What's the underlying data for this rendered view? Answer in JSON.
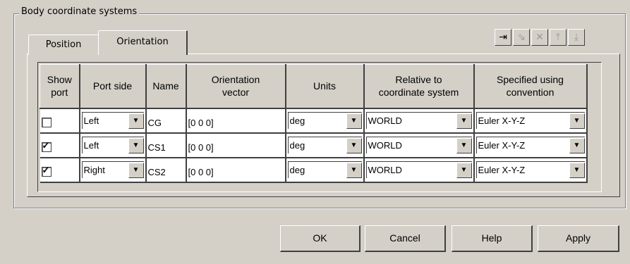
{
  "group": {
    "title": "Body coordinate systems"
  },
  "tabs": [
    {
      "label": "Position",
      "active": false
    },
    {
      "label": "Orientation",
      "active": true
    }
  ],
  "toolbar": [
    {
      "icon": "add-icon",
      "glyph": "⇥",
      "enabled": true
    },
    {
      "icon": "duplicate-icon",
      "glyph": "⇘",
      "enabled": false
    },
    {
      "icon": "delete-icon",
      "glyph": "✕",
      "enabled": false
    },
    {
      "icon": "move-up-icon",
      "glyph": "⤒",
      "enabled": false
    },
    {
      "icon": "move-down-icon",
      "glyph": "⤓",
      "enabled": false
    }
  ],
  "table": {
    "headers": [
      "Show\nport",
      "Port side",
      "Name",
      "Orientation\nvector",
      "Units",
      "Relative to\ncoordinate system",
      "Specified using\nconvention"
    ],
    "rows": [
      {
        "show_port": false,
        "port_side": "Left",
        "name": "CG",
        "vector": "[0 0 0]",
        "units": "deg",
        "relative": "WORLD",
        "convention": "Euler X-Y-Z"
      },
      {
        "show_port": true,
        "port_side": "Left",
        "name": "CS1",
        "vector": "[0 0 0]",
        "units": "deg",
        "relative": "WORLD",
        "convention": "Euler X-Y-Z"
      },
      {
        "show_port": true,
        "port_side": "Right",
        "name": "CS2",
        "vector": "[0 0 0]",
        "units": "deg",
        "relative": "WORLD",
        "convention": "Euler X-Y-Z"
      }
    ]
  },
  "buttons": {
    "ok": "OK",
    "cancel": "Cancel",
    "help": "Help",
    "apply": "Apply"
  },
  "colors": {
    "background": "#d4d0c8",
    "cell": "#ffffff"
  }
}
